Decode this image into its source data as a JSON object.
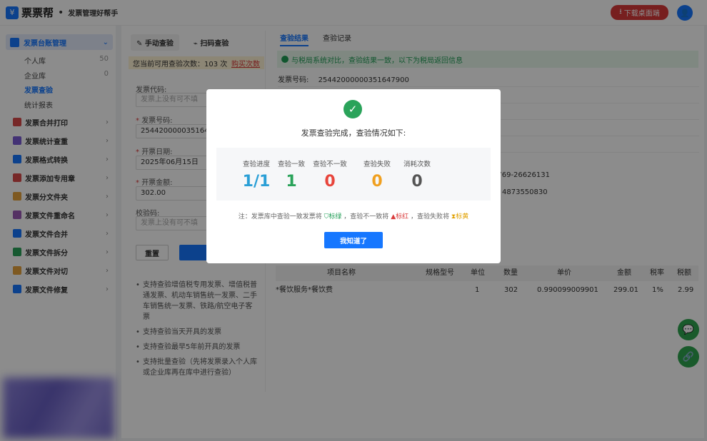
{
  "header": {
    "logo_icon": "ticket-icon",
    "brand": "票票帮",
    "slogan": "发票管理好帮手",
    "download_label": "下载桌面端"
  },
  "sidebar": {
    "section_label": "发票台账管理",
    "subitems": [
      {
        "label": "个人库",
        "count": "50"
      },
      {
        "label": "企业库",
        "count": "0"
      },
      {
        "label": "发票查验",
        "count": ""
      },
      {
        "label": "统计报表",
        "count": ""
      }
    ],
    "items": [
      {
        "label": "发票合并打印",
        "icon": "printer-icon",
        "color": "#d94a4a"
      },
      {
        "label": "发票统计查重",
        "icon": "stats-icon",
        "color": "#7b5cd6"
      },
      {
        "label": "发票格式转换",
        "icon": "convert-icon",
        "color": "#1677ff"
      },
      {
        "label": "发票添加专用章",
        "icon": "stamp-icon",
        "color": "#d94a4a"
      },
      {
        "label": "发票分文件夹",
        "icon": "folder-icon",
        "color": "#e6a23c"
      },
      {
        "label": "发票文件重命名",
        "icon": "rename-icon",
        "color": "#9b59b6"
      },
      {
        "label": "发票文件合并",
        "icon": "merge-icon",
        "color": "#1677ff"
      },
      {
        "label": "发票文件拆分",
        "icon": "split-icon",
        "color": "#2aa35a"
      },
      {
        "label": "发票文件对切",
        "icon": "cut-icon",
        "color": "#e6a23c"
      },
      {
        "label": "发票文件修复",
        "icon": "repair-icon",
        "color": "#1677ff"
      }
    ]
  },
  "check_panel": {
    "tabs": [
      "手动查验",
      "扫码查验"
    ],
    "notice": "您当前可用查验次数：103 次",
    "buy_label": "购买次数",
    "fields": [
      {
        "label": "发票代码:",
        "required": false,
        "value": "",
        "placeholder": "发票上没有可不填"
      },
      {
        "label": "发票号码:",
        "required": true,
        "value": "2544200000351647",
        "placeholder": ""
      },
      {
        "label": "开票日期:",
        "required": true,
        "value": "2025年06月15日",
        "placeholder": ""
      },
      {
        "label": "开票金额:",
        "required": true,
        "value": "302.00",
        "placeholder": ""
      },
      {
        "label": "校验码:",
        "required": false,
        "value": "",
        "placeholder": "发票上没有可不填"
      }
    ],
    "reset_label": "重置",
    "tips": [
      "支持查验增值税专用发票、增值税普通发票、机动车销售统一发票、二手车销售统一发票、铁路/航空电子客票",
      "支持查验当天开具的发票",
      "支持查验最早5年前开具的发票",
      "支持批量查验（先将发票录入个人库或企业库再在库中进行查验）"
    ]
  },
  "result_panel": {
    "tabs": [
      "查验结果",
      "查验记录"
    ],
    "success_text": "与税局系统对比，查验结果一致，以下为税局返回信息",
    "invoice_no_label": "发票号码:",
    "invoice_no": "25442000000351647900",
    "phone1": "0769-26626131",
    "phone2": "4873550830",
    "table": {
      "headers": [
        "项目名称",
        "规格型号",
        "单位",
        "数量",
        "单价",
        "金额",
        "税率",
        "税额"
      ],
      "rows": [
        [
          "*餐饮服务*餐饮费",
          "",
          "1",
          "302",
          "0.990099009901",
          "299.01",
          "1%",
          "2.99"
        ]
      ]
    }
  },
  "modal": {
    "title": "发票查验完成，查验情况如下:",
    "stats": [
      {
        "label": "查验进度",
        "value": "1/1",
        "color": "#2a9fd6"
      },
      {
        "label": "查验一致",
        "value": "1",
        "color": "#2aa35a"
      },
      {
        "label": "查验不一致",
        "value": "0",
        "color": "#e8453c"
      },
      {
        "label": "查验失败",
        "value": "0",
        "color": "#f0a020"
      },
      {
        "label": "消耗次数",
        "value": "0",
        "color": "#555555"
      }
    ],
    "note_prefix": "注：发票库中查验一致发票将",
    "note_green": "标绿",
    "note_mid": "，查验不一致将",
    "note_red": "标红",
    "note_mid2": "，查验失败将",
    "note_yellow": "标黄",
    "ok_label": "我知道了"
  }
}
